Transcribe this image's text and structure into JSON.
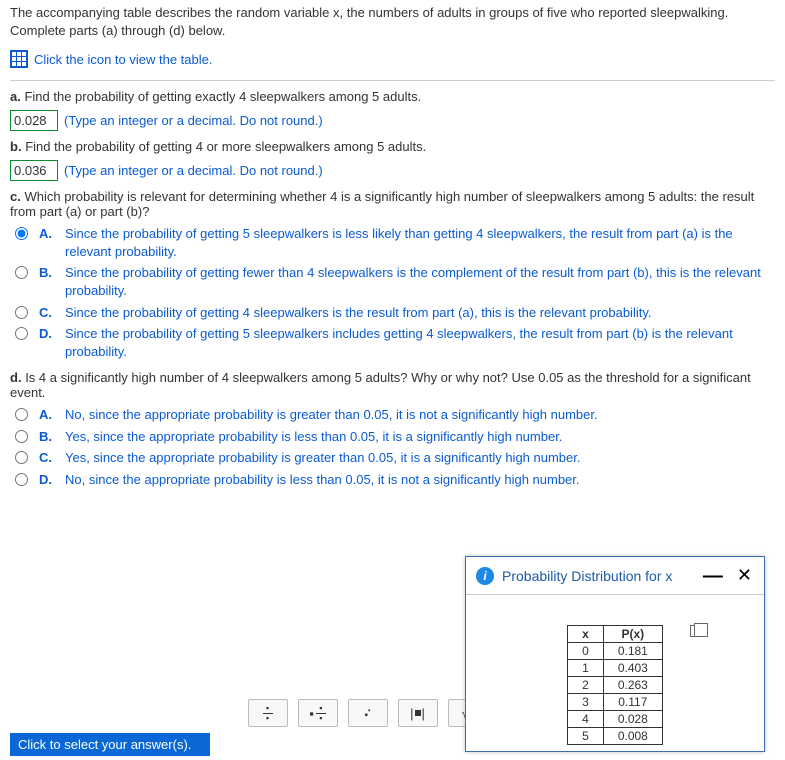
{
  "intro": "The accompanying table describes the random variable x, the numbers of adults in groups of five who reported sleepwalking. Complete parts (a) through (d) below.",
  "view_table_link": "Click the icon to view the table.",
  "part_a": {
    "label": "a.",
    "text": "Find the probability of getting exactly 4 sleepwalkers among 5 adults.",
    "value": "0.028",
    "hint": "(Type an integer or a decimal. Do not round.)"
  },
  "part_b": {
    "label": "b.",
    "text": "Find the probability of getting 4 or more sleepwalkers among 5 adults.",
    "value": "0.036",
    "hint": "(Type an integer or a decimal. Do not round.)"
  },
  "part_c": {
    "label": "c.",
    "text": "Which probability is relevant for determining whether 4 is a significantly high number of sleepwalkers among 5 adults: the result from part (a) or part (b)?",
    "options": {
      "A": "Since the probability of getting 5 sleepwalkers is less likely than getting 4 sleepwalkers, the result from part (a) is the relevant probability.",
      "B": "Since the probability of getting fewer than 4 sleepwalkers is the complement of the result from part (b), this is the relevant probability.",
      "C": "Since the probability of getting 4 sleepwalkers is the result from part (a), this is the relevant probability.",
      "D": "Since the probability of getting 5 sleepwalkers includes getting 4 sleepwalkers, the result from part (b) is the relevant probability."
    },
    "selected": "A"
  },
  "part_d": {
    "label": "d.",
    "text": "Is 4 a significantly high number of 4 sleepwalkers among 5 adults? Why or why not? Use 0.05 as the threshold for a significant event.",
    "options": {
      "A": "No, since the appropriate probability is greater than 0.05, it is not a significantly high number.",
      "B": "Yes, since the appropriate probability is less than 0.05, it is a significantly high number.",
      "C": "Yes, since the appropriate probability is greater than 0.05, it is a significantly high number.",
      "D": "No, since the appropriate probability is less than 0.05, it is not a significantly high number."
    }
  },
  "status": "Click to select your answer(s).",
  "popup": {
    "title": "Probability Distribution for x",
    "headers": {
      "x": "x",
      "px": "P(x)"
    }
  },
  "chart_data": {
    "type": "table",
    "title": "Probability Distribution for x",
    "columns": [
      "x",
      "P(x)"
    ],
    "rows": [
      {
        "x": 0,
        "px": "0.181"
      },
      {
        "x": 1,
        "px": "0.403"
      },
      {
        "x": 2,
        "px": "0.263"
      },
      {
        "x": 3,
        "px": "0.117"
      },
      {
        "x": 4,
        "px": "0.028"
      },
      {
        "x": 5,
        "px": "0.008"
      }
    ]
  }
}
